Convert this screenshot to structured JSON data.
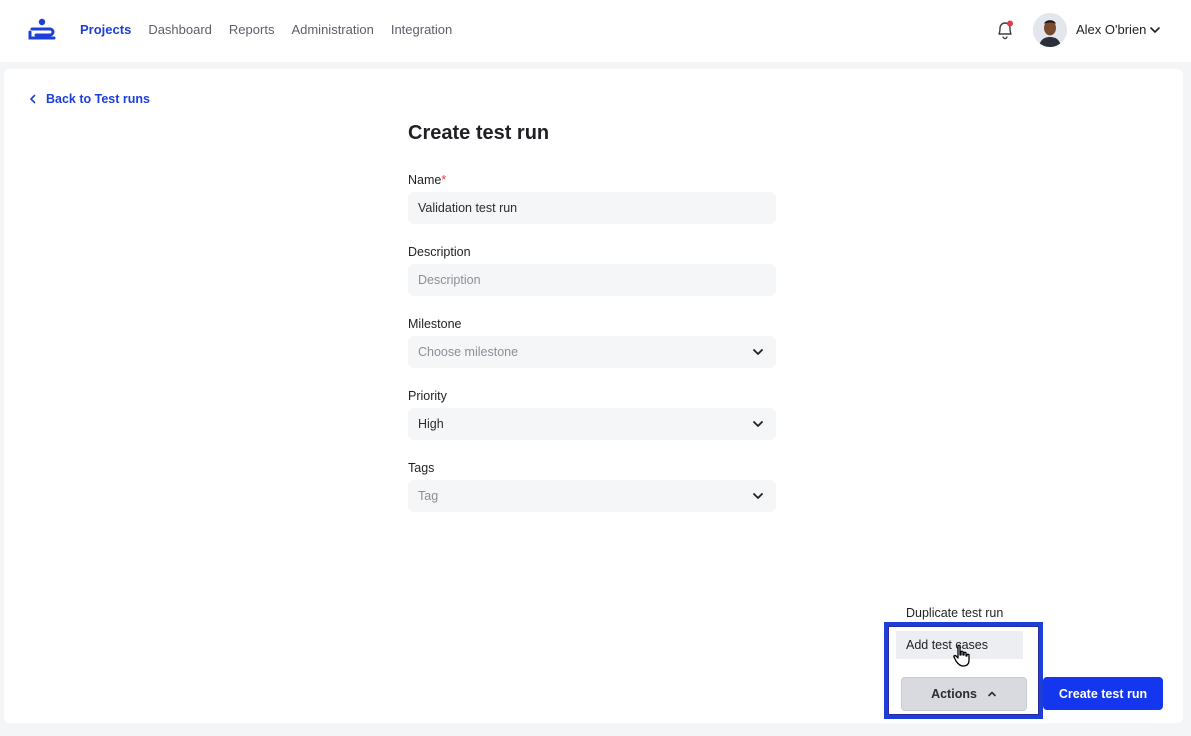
{
  "nav": {
    "items": [
      {
        "label": "Projects",
        "active": true
      },
      {
        "label": "Dashboard",
        "active": false
      },
      {
        "label": "Reports",
        "active": false
      },
      {
        "label": "Administration",
        "active": false
      },
      {
        "label": "Integration",
        "active": false
      }
    ]
  },
  "user": {
    "name": "Alex O'brien",
    "notification_dot_color": "#e23b4a"
  },
  "back_link": {
    "label": "Back to Test runs"
  },
  "form": {
    "title": "Create test run",
    "name": {
      "label": "Name",
      "required_mark": "*",
      "value": "Validation test run"
    },
    "description": {
      "label": "Description",
      "placeholder": "Description"
    },
    "milestone": {
      "label": "Milestone",
      "placeholder": "Choose milestone"
    },
    "priority": {
      "label": "Priority",
      "value": "High"
    },
    "tags": {
      "label": "Tags",
      "placeholder": "Tag"
    }
  },
  "actions_menu": {
    "items": [
      {
        "label": "Duplicate test run"
      },
      {
        "label": "Add test cases"
      }
    ]
  },
  "buttons": {
    "actions": "Actions",
    "create": "Create test run"
  },
  "colors": {
    "accent": "#1d3fd9",
    "primary_button": "#1336ee"
  }
}
